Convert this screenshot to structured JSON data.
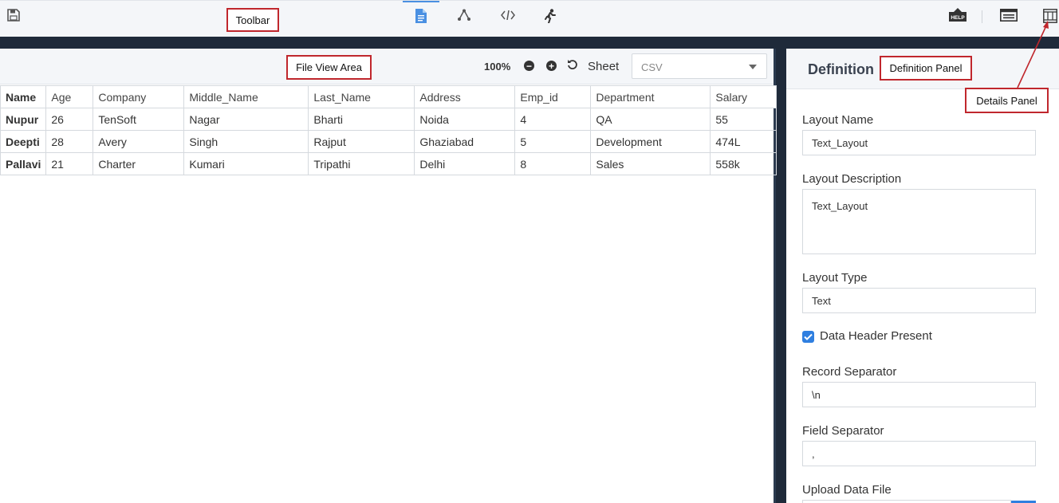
{
  "annotations": {
    "toolbar": "Toolbar",
    "file_view_area": "File View Area",
    "definition_panel": "Definition Panel",
    "details_panel": "Details Panel"
  },
  "toolbar": {
    "left_icon": "save-icon",
    "center_icons": [
      "file-document-icon",
      "graph-nodes-icon",
      "code-icon",
      "run-icon"
    ],
    "active_tab": "file-document-icon",
    "right_icons": [
      "help-icon",
      "list-view-icon",
      "details-panel-icon"
    ],
    "help_badge_text": "HELP",
    "accent_color": "#4a90e2"
  },
  "file_view": {
    "zoom": "100%",
    "zoom_out_symbol": "−",
    "zoom_in_symbol": "+",
    "sheet_label": "Sheet",
    "sheet_value": "CSV"
  },
  "table": {
    "columns": [
      "Name",
      "Age",
      "Company",
      "Middle_Name",
      "Last_Name",
      "Address",
      "Emp_id",
      "Department",
      "Salary"
    ],
    "rows": [
      [
        "Nupur",
        "26",
        "TenSoft",
        "Nagar",
        "Bharti",
        "Noida",
        "4",
        "QA",
        "55"
      ],
      [
        "Deepti",
        "28",
        "Avery",
        "Singh",
        "Rajput",
        "Ghaziabad",
        "5",
        "Development",
        "474L"
      ],
      [
        "Pallavi",
        "21",
        "Charter",
        "Kumari",
        "Tripathi",
        "Delhi",
        "8",
        "Sales",
        "558k"
      ]
    ]
  },
  "definition": {
    "title": "Definition",
    "layout_name_label": "Layout Name",
    "layout_name_value": "Text_Layout",
    "layout_description_label": "Layout Description",
    "layout_description_value": "Text_Layout",
    "layout_type_label": "Layout Type",
    "layout_type_value": "Text",
    "data_header_label": "Data Header Present",
    "data_header_checked": true,
    "record_separator_label": "Record Separator",
    "record_separator_value": "\\n",
    "field_separator_label": "Field Separator",
    "field_separator_value": ",",
    "upload_label": "Upload Data File",
    "checkbox_color": "#2f7fe0"
  }
}
